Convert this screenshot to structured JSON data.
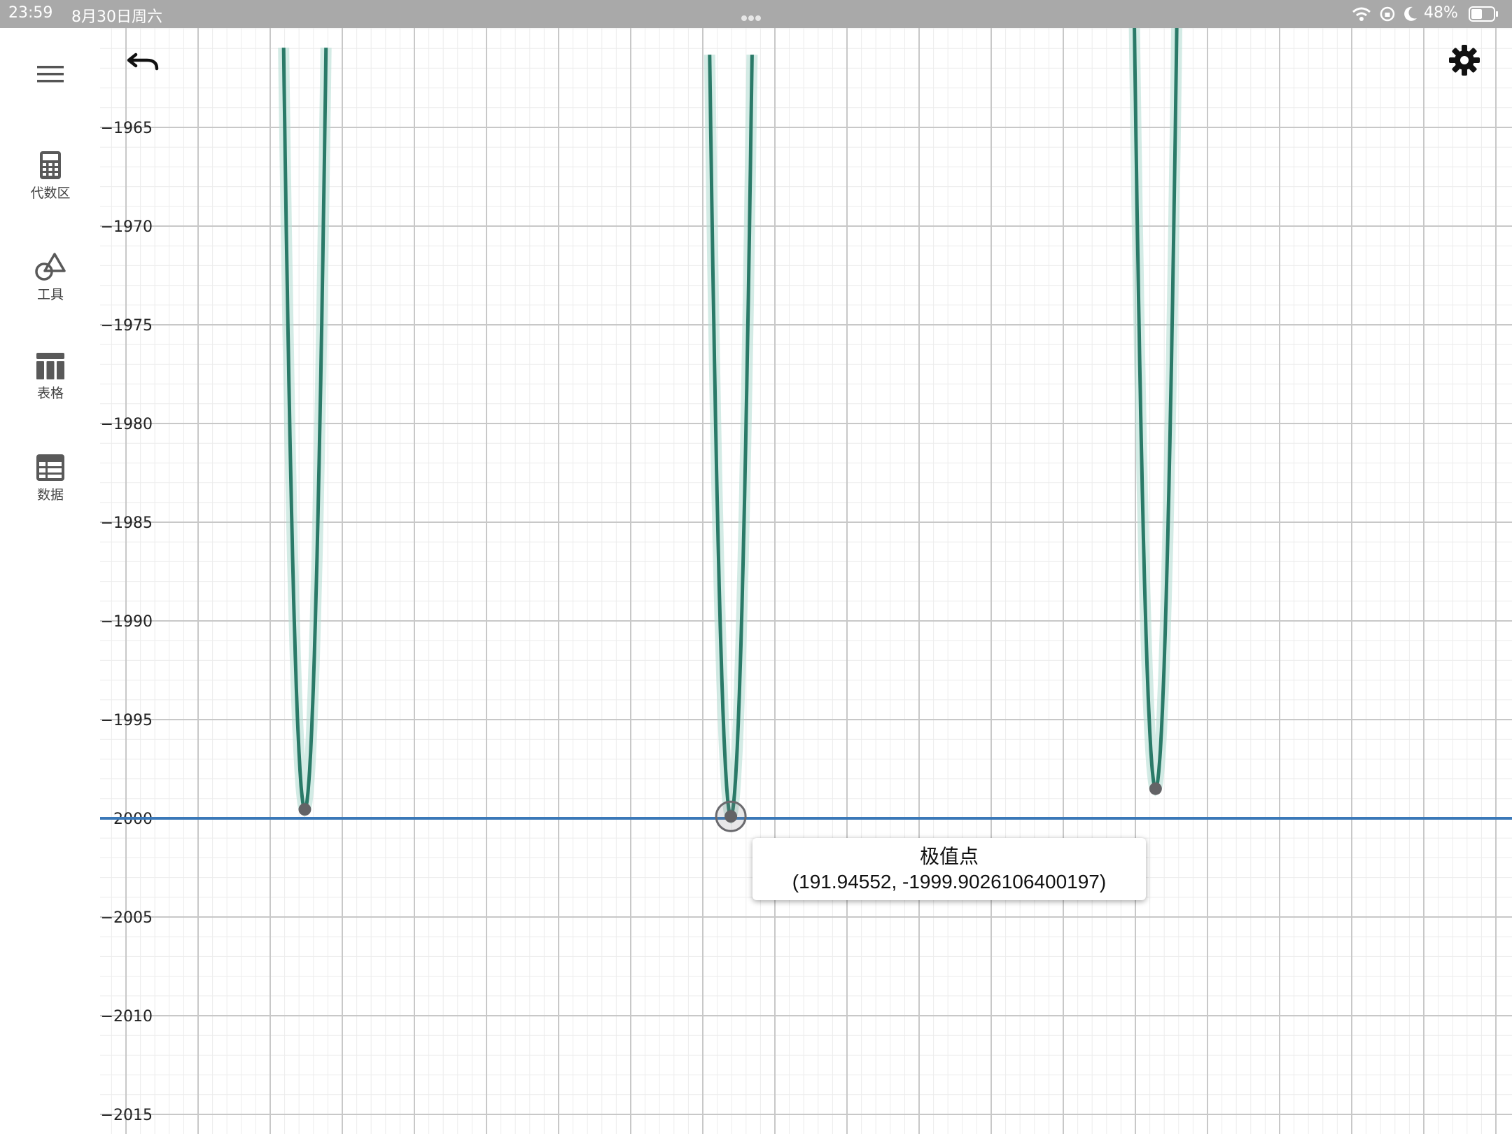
{
  "status_bar": {
    "time": "23:59",
    "date": "8月30日周六",
    "battery": "48%"
  },
  "sidebar": {
    "items": [
      {
        "label": "代数区",
        "icon": "calculator-icon"
      },
      {
        "label": "工具",
        "icon": "shapes-tools-icon"
      },
      {
        "label": "表格",
        "icon": "table-icon"
      },
      {
        "label": "数据",
        "icon": "spreadsheet-icon"
      }
    ]
  },
  "toolbar": {
    "menu_icon": "menu-icon",
    "undo_icon": "undo-icon",
    "settings_icon": "gear-icon"
  },
  "tooltip": {
    "title": "极值点",
    "coords": "(191.94552, -1999.9026106400197)"
  },
  "colors": {
    "curve": "#2a7a68",
    "curve_halo": "#b5ddd3",
    "horizontal_line": "#3a78b8",
    "point": "#636366",
    "grid_major": "#c8c8c8",
    "grid_minor": "#ececec"
  },
  "chart_data": {
    "type": "line",
    "xlim": [
      145,
      245
    ],
    "ylim": [
      -2016,
      -1960
    ],
    "x_ticks": [
      150,
      155,
      160,
      165,
      170,
      175,
      180,
      185,
      190,
      195,
      200,
      205,
      210,
      215,
      220,
      225,
      230,
      235,
      240,
      245
    ],
    "y_ticks": [
      -1965,
      -1970,
      -1975,
      -1980,
      -1985,
      -1990,
      -1995,
      -2000,
      -2005,
      -2010,
      -2015
    ],
    "grid": true,
    "horizontal_line": {
      "y": -2000
    },
    "minima": [
      {
        "x": 162.4,
        "y": -1999.55
      },
      {
        "x": 191.94552,
        "y": -1999.9026106400197,
        "selected": true
      },
      {
        "x": 221.4,
        "y": -1998.5
      }
    ],
    "curve_half_width": 1.4,
    "curve_depth_at_half_width": 35
  }
}
